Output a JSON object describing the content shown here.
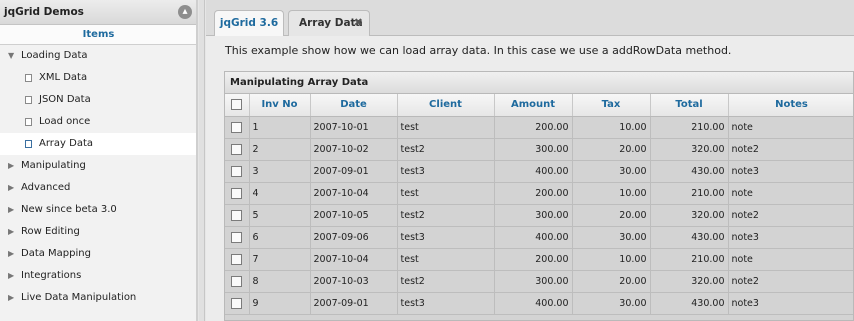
{
  "sidebar": {
    "title": "jqGrid Demos",
    "collapse_icon": "chevron-up-icon",
    "subheader": "Items",
    "items": [
      {
        "label": "Loading Data",
        "type": "parent",
        "expanded": true
      },
      {
        "label": "XML Data",
        "type": "child"
      },
      {
        "label": "JSON Data",
        "type": "child"
      },
      {
        "label": "Load once",
        "type": "child"
      },
      {
        "label": "Array Data",
        "type": "child",
        "selected": true
      },
      {
        "label": "Manipulating",
        "type": "parent"
      },
      {
        "label": "Advanced",
        "type": "parent"
      },
      {
        "label": "New since beta 3.0",
        "type": "parent"
      },
      {
        "label": "Row Editing",
        "type": "parent"
      },
      {
        "label": "Data Mapping",
        "type": "parent"
      },
      {
        "label": "Integrations",
        "type": "parent"
      },
      {
        "label": "Live Data Manipulation",
        "type": "parent"
      }
    ]
  },
  "tabs": [
    {
      "label": "jqGrid 3.6"
    },
    {
      "label": "Array Data",
      "active": true,
      "close": "✖"
    }
  ],
  "main": {
    "description": "This example show how we can load array data. In this case we use a addRowData method."
  },
  "grid": {
    "caption": "Manipulating Array Data",
    "columns": [
      "Inv No",
      "Date",
      "Client",
      "Amount",
      "Tax",
      "Total",
      "Notes"
    ],
    "rows": [
      [
        "1",
        "2007-10-01",
        "test",
        "200.00",
        "10.00",
        "210.00",
        "note"
      ],
      [
        "2",
        "2007-10-02",
        "test2",
        "300.00",
        "20.00",
        "320.00",
        "note2"
      ],
      [
        "3",
        "2007-09-01",
        "test3",
        "400.00",
        "30.00",
        "430.00",
        "note3"
      ],
      [
        "4",
        "2007-10-04",
        "test",
        "200.00",
        "10.00",
        "210.00",
        "note"
      ],
      [
        "5",
        "2007-10-05",
        "test2",
        "300.00",
        "20.00",
        "320.00",
        "note2"
      ],
      [
        "6",
        "2007-09-06",
        "test3",
        "400.00",
        "30.00",
        "430.00",
        "note3"
      ],
      [
        "7",
        "2007-10-04",
        "test",
        "200.00",
        "10.00",
        "210.00",
        "note"
      ],
      [
        "8",
        "2007-10-03",
        "test2",
        "300.00",
        "20.00",
        "320.00",
        "note2"
      ],
      [
        "9",
        "2007-09-01",
        "test3",
        "400.00",
        "30.00",
        "430.00",
        "note3"
      ]
    ]
  },
  "colors": {
    "accent": "#1e6a9e",
    "row_bg": "#d3d3d3",
    "sidebar_bg": "#f2f2f2"
  }
}
